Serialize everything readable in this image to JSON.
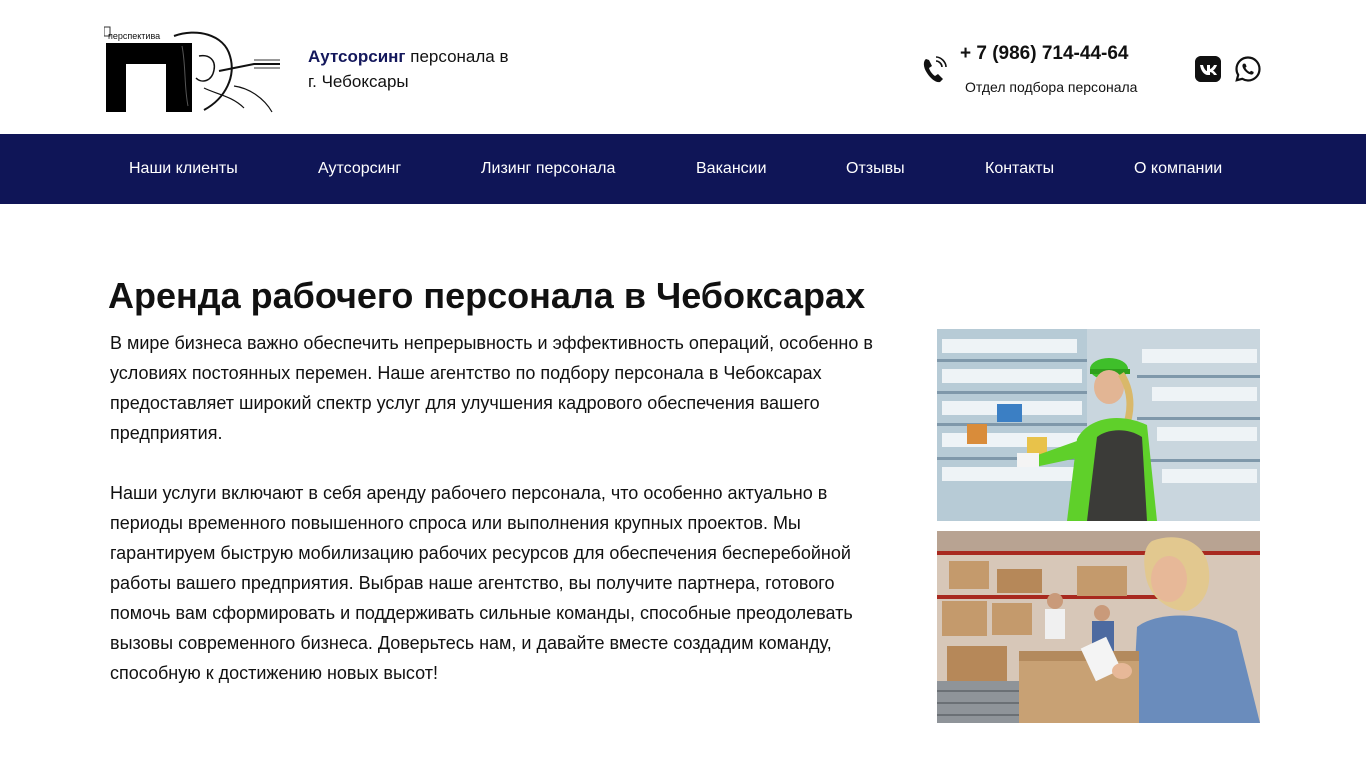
{
  "header": {
    "logo_text": "перспектива",
    "tagline_bold": "Аутсорсинг",
    "tagline_rest": "персонала в",
    "tagline_line2": "г. Чебоксары",
    "phone": "+ 7 (986) 714-44-64",
    "phone_sub": "Отдел подбора персонала",
    "icons": [
      "phone-icon",
      "vk-icon",
      "whatsapp-icon"
    ]
  },
  "nav": {
    "items": [
      {
        "label": "Наши клиенты"
      },
      {
        "label": "Аутсорсинг"
      },
      {
        "label": "Лизинг персонала"
      },
      {
        "label": "Вакансии"
      },
      {
        "label": "Отзывы"
      },
      {
        "label": "Контакты"
      },
      {
        "label": "О компании"
      }
    ]
  },
  "main": {
    "title": "Аренда рабочего персонала в Чебоксарах",
    "paragraphs": [
      "В мире бизнеса важно обеспечить непрерывность и эффективность операций, особенно в условиях постоянных перемен. Наше агентство по подбору персонала в Чебоксарах предоставляет широкий спектр услуг для улучшения кадрового обеспечения вашего предприятия.",
      "Наши услуги включают в себя аренду рабочего персонала, что особенно актуально в периоды временного повышенного спроса или выполнения крупных проектов. Мы гарантируем быструю мобилизацию рабочих ресурсов для обеспечения бесперебойной работы вашего предприятия. Выбрав наше агентство, вы получите партнера, готового помочь вам сформировать и поддерживать сильные команды, способные преодолевать вызовы современного бизнеса. Доверьтесь нам, и давайте вместе создадим команду, способную к достижению новых высот!"
    ]
  },
  "colors": {
    "nav_bg": "#0f1557",
    "accent_text": "#14185c",
    "worker_vest": "#5fd02a"
  }
}
